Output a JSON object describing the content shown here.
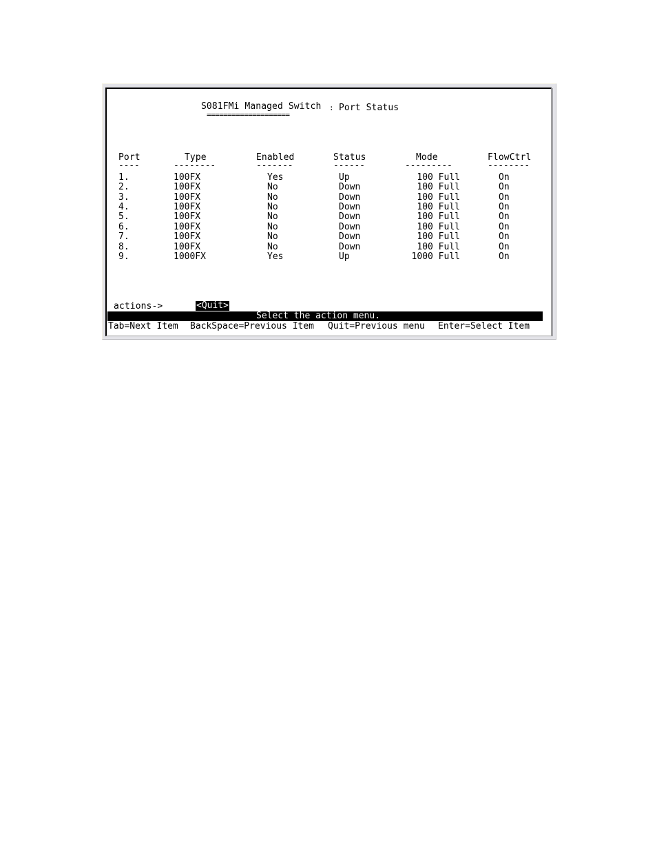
{
  "header": {
    "title": "S081FMi Managed Switch",
    "underline": "====================",
    "separator": ":",
    "subtitle": "Port Status"
  },
  "table": {
    "columns": [
      {
        "label": "Port",
        "dashes": "----"
      },
      {
        "label": "Type",
        "dashes": "--------"
      },
      {
        "label": "Enabled",
        "dashes": "-------"
      },
      {
        "label": "Status",
        "dashes": "------"
      },
      {
        "label": "Mode",
        "dashes": "---------"
      },
      {
        "label": "FlowCtrl",
        "dashes": "--------"
      }
    ],
    "rows": [
      {
        "port": "1.",
        "type": "100FX",
        "enabled": "Yes",
        "status": "Up",
        "mode": "100 Full",
        "flowctrl": "On"
      },
      {
        "port": "2.",
        "type": "100FX",
        "enabled": "No",
        "status": "Down",
        "mode": "100 Full",
        "flowctrl": "On"
      },
      {
        "port": "3.",
        "type": "100FX",
        "enabled": "No",
        "status": "Down",
        "mode": "100 Full",
        "flowctrl": "On"
      },
      {
        "port": "4.",
        "type": "100FX",
        "enabled": "No",
        "status": "Down",
        "mode": "100 Full",
        "flowctrl": "On"
      },
      {
        "port": "5.",
        "type": "100FX",
        "enabled": "No",
        "status": "Down",
        "mode": "100 Full",
        "flowctrl": "On"
      },
      {
        "port": "6.",
        "type": "100FX",
        "enabled": "No",
        "status": "Down",
        "mode": "100 Full",
        "flowctrl": "On"
      },
      {
        "port": "7.",
        "type": "100FX",
        "enabled": "No",
        "status": "Down",
        "mode": "100 Full",
        "flowctrl": "On"
      },
      {
        "port": "8.",
        "type": "100FX",
        "enabled": "No",
        "status": "Down",
        "mode": "100 Full",
        "flowctrl": "On"
      },
      {
        "port": "9.",
        "type": "1000FX",
        "enabled": "Yes",
        "status": "Up",
        "mode": "1000 Full",
        "flowctrl": "On"
      }
    ]
  },
  "actions": {
    "label": "actions->",
    "quit_button": "<Quit>"
  },
  "status_bar": {
    "message": "Select the action menu."
  },
  "help": {
    "items": [
      "Tab=Next Item",
      "BackSpace=Previous Item",
      "Quit=Previous menu",
      "Enter=Select Item"
    ]
  },
  "colors": {
    "terminal_bg": "#ffffff",
    "terminal_fg": "#000000",
    "highlight_bg": "#000000",
    "highlight_fg": "#ffffff",
    "frame_bg": "#e3e3e8"
  }
}
